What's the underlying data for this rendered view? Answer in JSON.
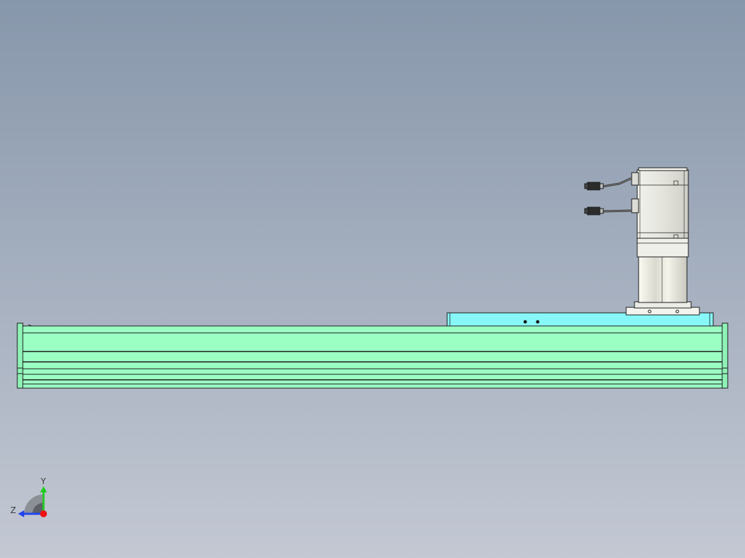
{
  "viewport": {
    "background_top": "#8797ab",
    "background_bottom": "#c3c8d3"
  },
  "model": {
    "rail_color": "#9bffc4",
    "carriage_color": "#87f7f7",
    "motor_color": "#e9e9e4",
    "outline_color": "#1a1a1a"
  },
  "triad": {
    "y_label": "Y",
    "z_label": "Z",
    "y_color": "#22cc22",
    "z_color": "#2244ee",
    "x_color": "#ee1111"
  }
}
